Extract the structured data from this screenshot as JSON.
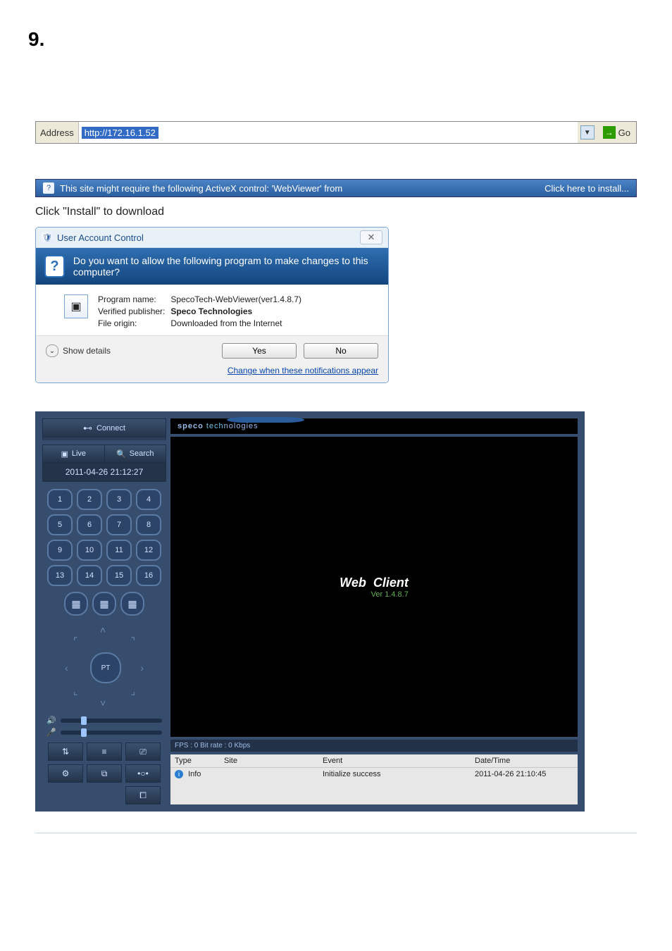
{
  "heading": "9.",
  "addressBar": {
    "label": "Address",
    "url": "http://172.16.1.52",
    "go": "Go"
  },
  "infoBar": {
    "text": "This site might require the following ActiveX control: 'WebViewer' from",
    "action": "Click here to install..."
  },
  "instruction": "Click \"Install\" to download",
  "uac": {
    "title": "User Account Control",
    "banner": "Do you want to allow the following program to make changes to this computer?",
    "rows": {
      "programLabel": "Program name:",
      "programValue": "SpecoTech-WebViewer(ver1.4.8.7)",
      "publisherLabel": "Verified publisher:",
      "publisherValue": "Speco Technologies",
      "originLabel": "File origin:",
      "originValue": "Downloaded from the Internet"
    },
    "details": "Show details",
    "yes": "Yes",
    "no": "No",
    "link": "Change when these notifications appear"
  },
  "app": {
    "connect": "Connect",
    "live": "Live",
    "search": "Search",
    "clock": "2011-04-26 21:12:27",
    "channels": [
      "1",
      "2",
      "3",
      "4",
      "5",
      "6",
      "7",
      "8",
      "9",
      "10",
      "11",
      "12",
      "13",
      "14",
      "15",
      "16"
    ],
    "ptz": "PT",
    "brand": "speco technologies",
    "webClient": {
      "title": "Web",
      "title2": "Client",
      "ver": "Ver 1.4.8.7"
    },
    "fps": "FPS : 0   Bit rate : 0 Kbps",
    "eventHeader": {
      "type": "Type",
      "site": "Site",
      "event": "Event",
      "dt": "Date/Time"
    },
    "eventRow": {
      "type": "Info",
      "site": "",
      "event": "Initialize success",
      "dt": "2011-04-26 21:10:45"
    }
  }
}
